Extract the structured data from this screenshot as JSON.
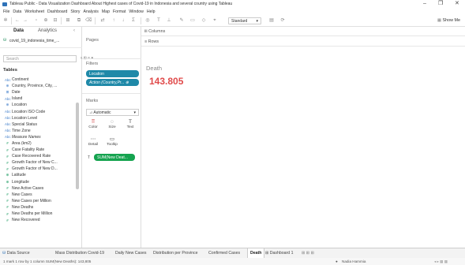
{
  "window": {
    "title": "Tableau Public - Data Visualization Dashboard About Highest cases of Covid-19 in Indonesia and several country using Tableau",
    "minimize": "–",
    "maximize": "❐",
    "close": "✕"
  },
  "menu": [
    "File",
    "Data",
    "Worksheet",
    "Dashboard",
    "Story",
    "Analysis",
    "Map",
    "Format",
    "Window",
    "Help"
  ],
  "toolbar": {
    "fit_dropdown": "Standard",
    "show_me": "Show Me"
  },
  "data_pane": {
    "tab_data": "Data",
    "tab_analytics": "Analytics",
    "datasource": "covid_19_indonesia_time_...",
    "search_placeholder": "Search",
    "tables_header": "Tables",
    "fields": [
      {
        "icon": "Abc",
        "label": "Continent",
        "kind": "dim",
        "italic": false
      },
      {
        "icon": "⊕",
        "label": "Country, Province, City, ...",
        "kind": "dim",
        "italic": false
      },
      {
        "icon": "⊞",
        "label": "Date",
        "kind": "dim",
        "italic": false
      },
      {
        "icon": "Abc",
        "label": "Island",
        "kind": "dim",
        "italic": false
      },
      {
        "icon": "⊕",
        "label": "Location",
        "kind": "dim",
        "italic": false
      },
      {
        "icon": "Abc",
        "label": "Location ISO Code",
        "kind": "dim",
        "italic": false
      },
      {
        "icon": "Abc",
        "label": "Location Level",
        "kind": "dim",
        "italic": false
      },
      {
        "icon": "Abc",
        "label": "Special Status",
        "kind": "dim",
        "italic": false
      },
      {
        "icon": "Abc",
        "label": "Time Zone",
        "kind": "dim",
        "italic": false
      },
      {
        "icon": "Abc",
        "label": "Measure Names",
        "kind": "dim",
        "italic": true
      },
      {
        "icon": "#",
        "label": "Area (km2)",
        "kind": "mea",
        "italic": false
      },
      {
        "icon": "#",
        "label": "Case Fatality Rate",
        "kind": "mea",
        "italic": false
      },
      {
        "icon": "#",
        "label": "Case Recovered Rate",
        "kind": "mea",
        "italic": false
      },
      {
        "icon": "#",
        "label": "Growth Factor of New C...",
        "kind": "mea",
        "italic": false
      },
      {
        "icon": "#",
        "label": "Growth Factor of New D...",
        "kind": "mea",
        "italic": false
      },
      {
        "icon": "⊕",
        "label": "Latitude",
        "kind": "mea",
        "italic": false
      },
      {
        "icon": "⊕",
        "label": "Longitude",
        "kind": "mea",
        "italic": false
      },
      {
        "icon": "#",
        "label": "New Active Cases",
        "kind": "mea",
        "italic": false
      },
      {
        "icon": "#",
        "label": "New Cases",
        "kind": "mea",
        "italic": false
      },
      {
        "icon": "#",
        "label": "New Cases per Million",
        "kind": "mea",
        "italic": false
      },
      {
        "icon": "#",
        "label": "New Deaths",
        "kind": "mea",
        "italic": false
      },
      {
        "icon": "#",
        "label": "New Deaths per Million",
        "kind": "mea",
        "italic": false
      },
      {
        "icon": "#",
        "label": "New Recovered",
        "kind": "mea",
        "italic": false
      }
    ]
  },
  "pages_pane": {
    "pages_header": "Pages",
    "filters_header": "Filters",
    "filter_pills": [
      "Location",
      "Action (Country,Pr... ⊕"
    ],
    "marks_header": "Marks",
    "marks_type": "Automatic",
    "mark_buttons": [
      {
        "glyph": "⠿",
        "label": "Color"
      },
      {
        "glyph": "◌",
        "label": "Size"
      },
      {
        "glyph": "T",
        "label": "Text"
      },
      {
        "glyph": "⋯",
        "label": "Detail"
      },
      {
        "glyph": "▭",
        "label": "Tooltip"
      }
    ],
    "measure_pill": "SUM(New Deat..."
  },
  "view": {
    "columns_label": "iii Columns",
    "rows_label": "≡ Rows",
    "sheet_title": "Death",
    "value": "143.805"
  },
  "sheet_tabs": [
    "Data Source",
    "Mass Distribution Covid-19",
    "Daily New Cases",
    "Distribution per Province",
    "Confirmed Cases",
    "Death",
    "Dashboard 1"
  ],
  "active_tab": "Death",
  "status": {
    "left": "1 mark   1 row by 1 column   SUM(New Deaths): 143,805",
    "user": "Nadia Hammia"
  }
}
